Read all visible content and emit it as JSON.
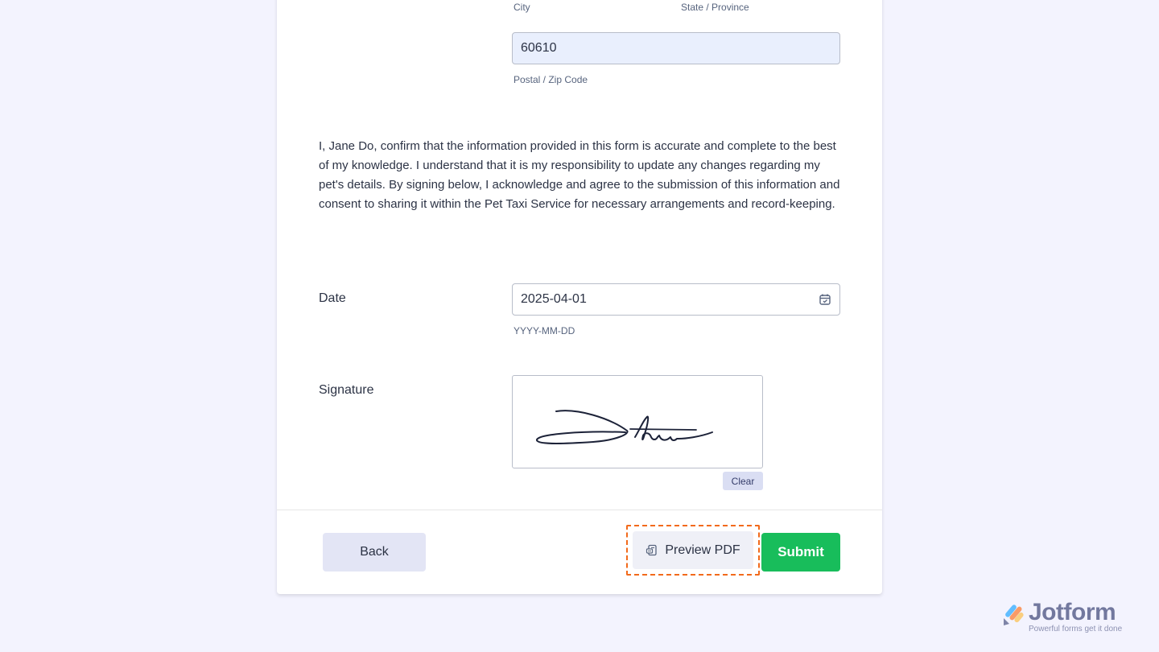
{
  "address": {
    "city_sublabel": "City",
    "state_sublabel": "State / Province",
    "zip_value": "60610",
    "zip_sublabel": "Postal / Zip Code"
  },
  "consent_text": "I, Jane Do, confirm that the information provided in this form is accurate and complete to the best of my knowledge. I understand that it is my responsibility to update any changes regarding my pet's details. By signing below, I acknowledge and agree to the submission of this information and consent to sharing it within the Pet Taxi Service for necessary arrangements and record-keeping.",
  "date": {
    "label": "Date",
    "value": "2025-04-01",
    "sublabel": "YYYY-MM-DD",
    "icon": "calendar-icon"
  },
  "signature": {
    "label": "Signature",
    "clear_label": "Clear"
  },
  "footer": {
    "back_label": "Back",
    "preview_label": "Preview PDF",
    "preview_icon": "pdf-document-icon",
    "submit_label": "Submit"
  },
  "branding": {
    "name": "Jotform",
    "tagline": "Powerful forms get it done"
  },
  "colors": {
    "background": "#f3f3fe",
    "submit": "#18bd5b",
    "highlight_outline": "#f26a1b",
    "zip_fill": "#e9effd"
  }
}
